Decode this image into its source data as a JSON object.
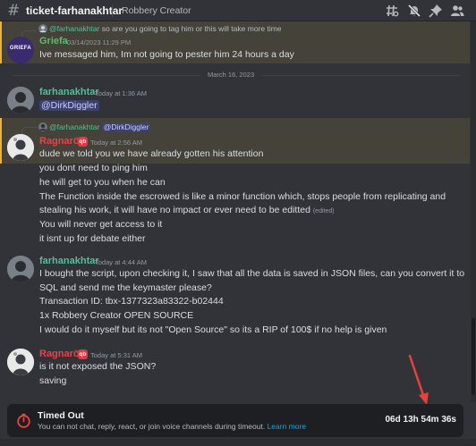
{
  "header": {
    "channel_name": "ticket-farhanakhtar",
    "topic": "Robbery Creator",
    "icons": [
      "threads-icon",
      "notification-muted-icon",
      "pin-icon",
      "members-icon"
    ]
  },
  "date_divider": "March 16, 2023",
  "messages": {
    "m0": {
      "reply_name": "@farhanakhtar",
      "reply_text": "so are you going to tag him or this will take more time",
      "author": "Griefa",
      "avatar_text": "GRIEFA",
      "timestamp": "03/14/2023 11:29 PM",
      "text": "Ive messaged him, Im not going to pester him 24 hours a day",
      "author_color": "#5fbb6c"
    },
    "m1": {
      "author": "farhanakhtar",
      "timestamp": "Today at 1:36 AM",
      "mention": "@DirkDiggler",
      "author_color": "#4fc09a"
    },
    "m2": {
      "reply_name": "@farhanakhtar",
      "reply_mention": "@DirkDiggler",
      "author": "Ragnarök",
      "badge": "qb",
      "timestamp": "Today at 2:56 AM",
      "author_color": "#ed4245",
      "lines": {
        "l0": "dude we told you we have already gotten his attention",
        "l1": "you dont need to ping him",
        "l2": "he will get to you when he can",
        "l3a": "The Function inside the escrowed is like a minor function which, stops people from replicating and",
        "l3b": "stealing his work, it will have no impact or ever need to be editted",
        "edited": "(edited)",
        "l4": "You will never get access to it",
        "l5": "it isnt up for debate either"
      }
    },
    "m3": {
      "author": "farhanakhtar",
      "timestamp": "Today at 4:44 AM",
      "author_color": "#4fc09a",
      "lines": {
        "l0": "I bought the script, upon checking it, I saw that all the data is saved in JSON files, can you convert it to",
        "l1": "SQL and send me the keymaster please?",
        "l2": "Transaction ID: tbx-1377323a83322-b02444",
        "l3": "1x Robbery Creator OPEN SOURCE",
        "l4": "I would do it myself but its not \"Open Source\" so its a RIP of 100$ if no help is given"
      }
    },
    "m4": {
      "author": "Ragnarök",
      "badge": "qb",
      "timestamp": "Today at 5:31 AM",
      "author_color": "#ed4245",
      "lines": {
        "l0": "is it not exposed the JSON?",
        "l1": "saving"
      }
    }
  },
  "timeout": {
    "title": "Timed Out",
    "subtitle": "You can not chat, reply, react, or join voice channels during timeout.",
    "link": "Learn more",
    "remaining": "06d 13h 54m 36s",
    "accent": "#ed4245"
  },
  "colors": {
    "background": "#313338",
    "highlight": "#45423a",
    "highlight_bar": "#f0b232",
    "link": "#00a8fc",
    "annotation_arrow": "#e8413a"
  }
}
